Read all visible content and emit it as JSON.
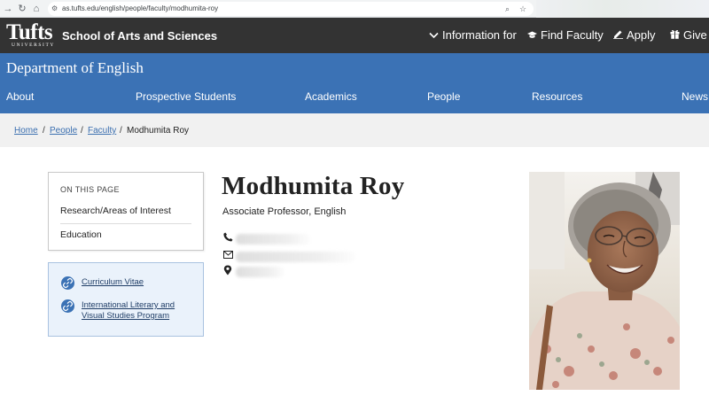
{
  "browser": {
    "url": "as.tufts.edu/english/people/faculty/modhumita-roy"
  },
  "header": {
    "logo_word": "Tufts",
    "logo_sub": "UNIVERSITY",
    "school_name": "School of Arts and Sciences",
    "nav": {
      "information_for": "Information for",
      "find_faculty": "Find Faculty",
      "apply": "Apply",
      "give": "Give"
    }
  },
  "department": {
    "title": "Department of English",
    "nav": {
      "about": "About",
      "prospective_students": "Prospective Students",
      "academics": "Academics",
      "people": "People",
      "resources": "Resources",
      "news": "News"
    }
  },
  "breadcrumb": {
    "home": "Home",
    "people": "People",
    "faculty": "Faculty",
    "current": "Modhumita Roy",
    "separator": "/"
  },
  "on_this_page": {
    "title": "ON THIS PAGE",
    "links": [
      "Research/Areas of Interest",
      "Education"
    ]
  },
  "resource_links": {
    "cv": "Curriculum Vitae",
    "program_line1": "International Literary and",
    "program_line2": "Visual Studies Program"
  },
  "profile": {
    "name": "Modhumita Roy",
    "title": "Associate Professor, English"
  },
  "colors": {
    "header_bg": "#333333",
    "department_blue": "#3b72b5",
    "breadcrumb_bg": "#f1f1f1",
    "link_blue": "#3b6fb0"
  }
}
